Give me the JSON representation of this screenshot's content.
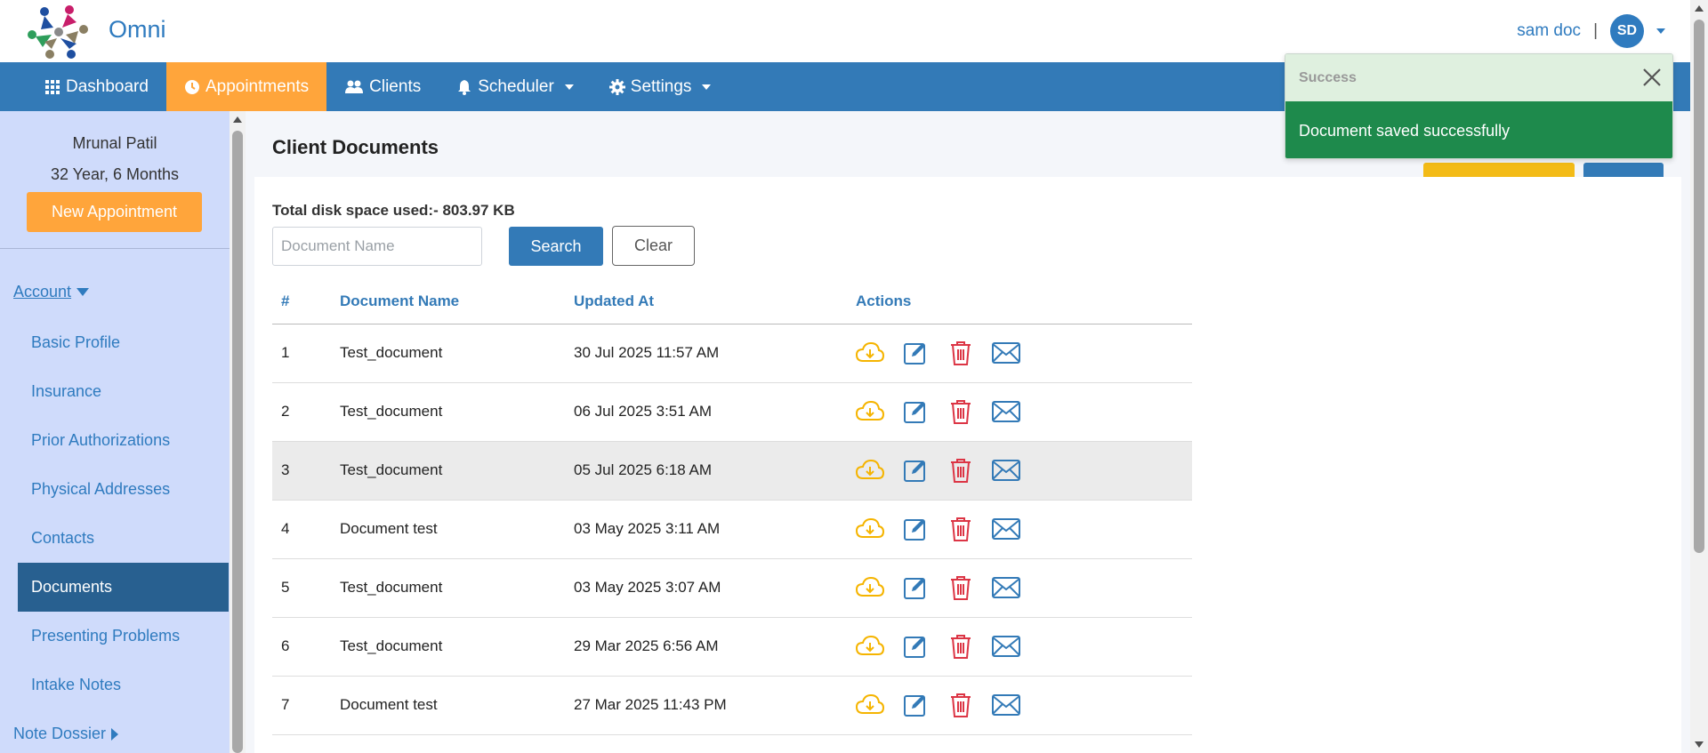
{
  "app": {
    "brand": "Omni"
  },
  "user": {
    "name": "sam doc",
    "separator": "|",
    "initials": "SD"
  },
  "nav": {
    "items": [
      {
        "label": "Dashboard",
        "icon": "grid-icon"
      },
      {
        "label": "Appointments",
        "icon": "clock-icon",
        "active": true
      },
      {
        "label": "Clients",
        "icon": "users-icon"
      },
      {
        "label": "Scheduler",
        "icon": "bell-icon",
        "dropdown": true
      },
      {
        "label": "Settings",
        "icon": "gear-icon",
        "dropdown": true
      }
    ]
  },
  "sidebar": {
    "client_name": "Mrunal Patil",
    "client_age": "32 Year, 6 Months",
    "new_appointment": "New Appointment",
    "account_label": "Account",
    "items": [
      {
        "label": "Basic Profile"
      },
      {
        "label": "Insurance"
      },
      {
        "label": "Prior Authorizations"
      },
      {
        "label": "Physical Addresses"
      },
      {
        "label": "Contacts"
      },
      {
        "label": "Documents",
        "active": true
      },
      {
        "label": "Presenting Problems"
      },
      {
        "label": "Intake Notes"
      }
    ],
    "note_dossier_label": "Note Dossier"
  },
  "main": {
    "title": "Client Documents",
    "disk_usage": "Total disk space used:- 803.97 KB",
    "search": {
      "placeholder": "Document Name",
      "value": ""
    },
    "search_button": "Search",
    "clear_button": "Clear",
    "table": {
      "headers": [
        "#",
        "Document Name",
        "Updated At",
        "Actions"
      ],
      "rows": [
        {
          "num": "1",
          "name": "Test_document",
          "updated": "30 Jul 2025 11:57 AM"
        },
        {
          "num": "2",
          "name": "Test_document",
          "updated": "06 Jul 2025 3:51 AM"
        },
        {
          "num": "3",
          "name": "Test_document",
          "updated": "05 Jul 2025 6:18 AM",
          "highlight": true
        },
        {
          "num": "4",
          "name": "Document test",
          "updated": "03 May 2025 3:11 AM"
        },
        {
          "num": "5",
          "name": "Test_document",
          "updated": "03 May 2025 3:07 AM"
        },
        {
          "num": "6",
          "name": "Test_document",
          "updated": "29 Mar 2025 6:56 AM"
        },
        {
          "num": "7",
          "name": "Document test",
          "updated": "27 Mar 2025 11:43 PM"
        }
      ],
      "action_icons": [
        "cloud-download-icon",
        "edit-icon",
        "trash-icon",
        "mail-icon"
      ]
    }
  },
  "toast": {
    "title": "Success",
    "message": "Document saved successfully"
  },
  "colors": {
    "primary": "#337ab7",
    "accent": "#ffa53b",
    "sidebar_bg": "#cfdbfb",
    "sidebar_active": "#286090",
    "download": "#f5b400",
    "delete": "#dc3545",
    "toast_success": "#1e8a4c"
  }
}
